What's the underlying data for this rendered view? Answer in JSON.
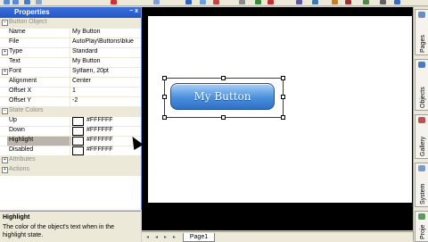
{
  "panel": {
    "title": "Properties",
    "title_buttons": "− x"
  },
  "categories": {
    "button_object": "Button Object",
    "state_colors": "State Colors",
    "attributes": "Attributes",
    "actions": "Actions"
  },
  "properties": [
    {
      "key": "Name",
      "value": "My Button"
    },
    {
      "key": "File",
      "value": "AutoPlay\\Buttons\\blue"
    },
    {
      "key": "Type",
      "value": "Standard"
    },
    {
      "key": "Text",
      "value": "My Button"
    },
    {
      "key": "Font",
      "value": "Sylfaen, 20pt"
    },
    {
      "key": "Alignment",
      "value": "Center"
    },
    {
      "key": "Offset X",
      "value": "1"
    },
    {
      "key": "Offset Y",
      "value": "-2"
    }
  ],
  "state_colors": [
    {
      "key": "Up",
      "value": "#FFFFFF"
    },
    {
      "key": "Down",
      "value": "#FFFFFF"
    },
    {
      "key": "Highlight",
      "value": "#FFFFFF"
    },
    {
      "key": "Disabled",
      "value": "#FFFFFF"
    }
  ],
  "description": {
    "heading": "Highlight",
    "body": "The color of the object's text when in the highlight state."
  },
  "canvas": {
    "button_text": "My Button",
    "page_tab": "Page1"
  },
  "right_tabs": [
    "Pages",
    "Objects",
    "Gallery",
    "System",
    "Proje"
  ],
  "colors": {
    "title_bar": "#2456c6",
    "button_blue": "#4a8fdc",
    "canvas_bg": "#000000",
    "page_bg": "#ffffff"
  }
}
